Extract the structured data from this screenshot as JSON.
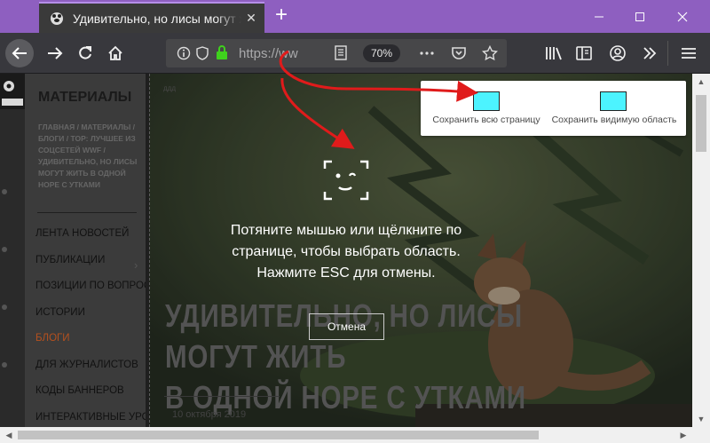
{
  "window": {
    "tab_title": "Удивительно, но лисы могут жить",
    "new_tab_label": "+"
  },
  "navbar": {
    "url": "https://ww",
    "zoom": "70%"
  },
  "site": {
    "sidebar_title": "МАТЕРИАЛЫ",
    "breadcrumbs": "ГЛАВНАЯ / МАТЕРИАЛЫ / БЛОГИ / ТОР: ЛУЧШЕЕ ИЗ СОЦСЕТЕЙ WWF / УДИВИТЕЛЬНО, НО ЛИСЫ МОГУТ ЖИТЬ В ОДНОЙ НОРЕ С УТКАМИ",
    "menu": [
      {
        "label": "ЛЕНТА НОВОСТЕЙ"
      },
      {
        "label": "ПУБЛИКАЦИИ"
      },
      {
        "label": "ПОЗИЦИИ ПО ВОПРОСАМ"
      },
      {
        "label": "ИСТОРИИ"
      },
      {
        "label": "БЛОГИ"
      },
      {
        "label": "ДЛЯ ЖУРНАЛИСТОВ"
      },
      {
        "label": "КОДЫ БАННЕРОВ"
      },
      {
        "label": "ИНТЕРАКТИВНЫЕ УРОКИ"
      }
    ],
    "headline_line1": "УДИВИТЕЛЬНО, НО ЛИСЫ МОГУТ ЖИТЬ",
    "headline_line2": "В ОДНОЙ НОРЕ С УТКАМИ",
    "date": "10 октября 2019",
    "small_link": "ддд"
  },
  "overlay": {
    "instruction_line1": "Потяните мышью или щёлкните по",
    "instruction_line2": "странице, чтобы выбрать область.",
    "instruction_line3": "Нажмите ESC для отмены.",
    "cancel_label": "Отмена",
    "save_full_label": "Сохранить всю страницу",
    "save_visible_label": "Сохранить видимую область"
  },
  "colors": {
    "titlebar": "#8e5fc0",
    "toolbar": "#38383d",
    "accent_thumb": "#4cf3ff",
    "arrow": "#e01b1b",
    "active_menu": "#b4501e"
  }
}
